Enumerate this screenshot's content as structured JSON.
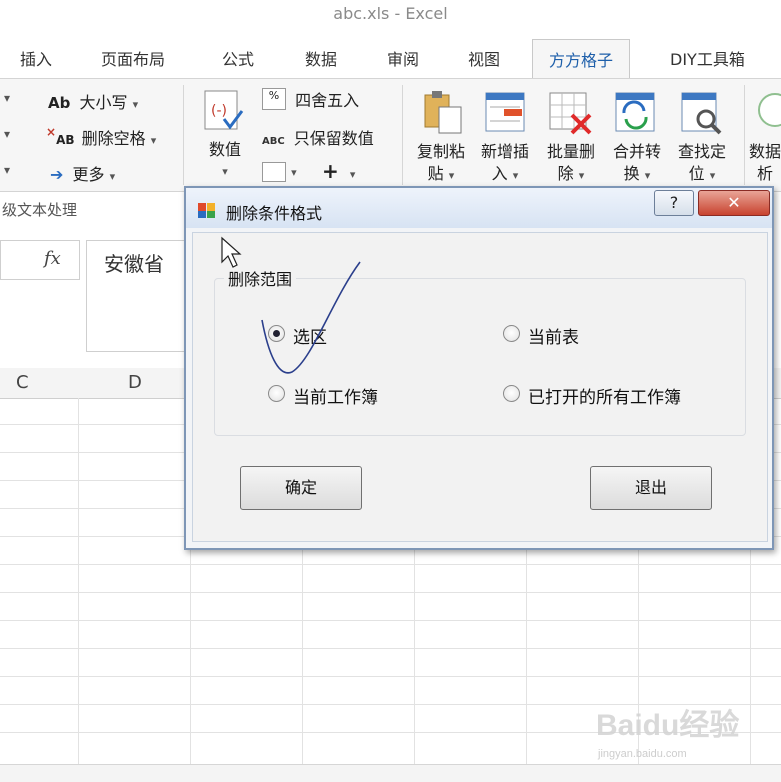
{
  "window": {
    "title": "abc.xls - Excel"
  },
  "ribbon_tabs": [
    {
      "label": "插入"
    },
    {
      "label": "页面布局"
    },
    {
      "label": "公式"
    },
    {
      "label": "数据"
    },
    {
      "label": "审阅"
    },
    {
      "label": "视图"
    },
    {
      "label": "方方格子",
      "active": true
    },
    {
      "label": "DIY工具箱"
    }
  ],
  "ribbon": {
    "text_group": {
      "case_label": "大小写",
      "case_icon_text": "Ab",
      "delete_space_label": "删除空格",
      "delete_space_icon_text": "AB",
      "more_label": "更多",
      "group_label": "级文本处理"
    },
    "number_group": {
      "value_label": "数值",
      "round_label": "四舍五入",
      "keep_value_label": "只保留数值",
      "keep_value_icon_text": "ABC",
      "plus_label": "+"
    },
    "tools": [
      {
        "label_line1": "复制粘",
        "label_line2": "贴"
      },
      {
        "label_line1": "新增插",
        "label_line2": "入"
      },
      {
        "label_line1": "批量删",
        "label_line2": "除"
      },
      {
        "label_line1": "合并转",
        "label_line2": "换"
      },
      {
        "label_line1": "查找定",
        "label_line2": "位"
      },
      {
        "label_line1": "数据",
        "label_line2": "析"
      }
    ]
  },
  "sheet": {
    "fx_label": "fx",
    "cell_value": "安徽省",
    "columns": [
      "C",
      "D"
    ]
  },
  "dialog": {
    "title": "删除条件格式",
    "help_label": "?",
    "close_label": "✕",
    "group_title": "删除范围",
    "options": [
      {
        "label": "选区",
        "checked": true
      },
      {
        "label": "当前表",
        "checked": false
      },
      {
        "label": "当前工作簿",
        "checked": false
      },
      {
        "label": "已打开的所有工作簿",
        "checked": false
      }
    ],
    "ok_label": "确定",
    "exit_label": "退出"
  },
  "watermark": {
    "text": "Baidu经验",
    "sub": "jingyan.baidu.com"
  },
  "colors": {
    "accent_tab": "#1e5faa",
    "dialog_border": "#7e96b6",
    "close_red": "#c8432f"
  }
}
